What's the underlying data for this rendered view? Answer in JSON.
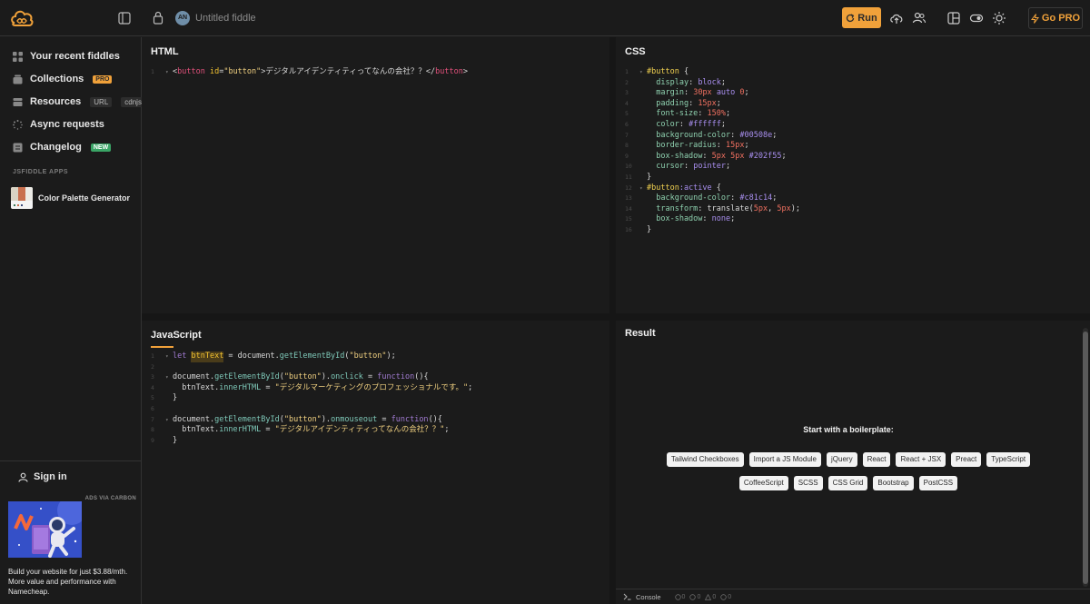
{
  "topbar": {
    "avatar_initials": "AN",
    "fiddle_title": "Untitled fiddle",
    "run_label": "Run",
    "go_pro_label": "Go PRO"
  },
  "sidebar": {
    "items": [
      {
        "label": "Your recent fiddles",
        "icon": "grid-icon"
      },
      {
        "label": "Collections",
        "icon": "box-icon",
        "tag": "PRO"
      },
      {
        "label": "Resources",
        "icon": "stack-icon",
        "tags": [
          "URL",
          "cdnjs"
        ]
      },
      {
        "label": "Async requests",
        "icon": "spinner-icon"
      },
      {
        "label": "Changelog",
        "icon": "list-icon",
        "tag": "NEW"
      }
    ],
    "apps_label": "JSFIDDLE APPS",
    "apps": [
      {
        "label": "Color Palette Generator",
        "icon": "palette-icon"
      }
    ],
    "sign_in": "Sign in",
    "ad_label": "ADS VIA CARBON",
    "ad_text": "Build your website for just $3.88/mth. More value and performance with Namecheap."
  },
  "panels": {
    "html": {
      "title": "HTML"
    },
    "css": {
      "title": "CSS"
    },
    "js": {
      "title": "JavaScript"
    },
    "result": {
      "title": "Result"
    }
  },
  "result": {
    "boilerplate_title": "Start with a boilerplate:",
    "row1": [
      "Tailwind Checkboxes",
      "Import a JS Module",
      "jQuery",
      "React",
      "React + JSX",
      "Preact",
      "TypeScript"
    ],
    "row2": [
      "CoffeeScript",
      "SCSS",
      "CSS Grid",
      "Bootstrap",
      "PostCSS"
    ]
  },
  "console": {
    "label": "Console",
    "counts": [
      "0",
      "0",
      "0",
      "0"
    ]
  },
  "code": {
    "html": [
      [
        [
          "<",
          "t-punc"
        ],
        [
          "button",
          "t-tag"
        ],
        [
          " id",
          "t-attr"
        ],
        [
          "=",
          "t-punc"
        ],
        [
          "\"button\"",
          "t-str"
        ],
        [
          ">デジタルアイデンティティってなんの会社？？</",
          "t-plain"
        ],
        [
          "button",
          "t-tag"
        ],
        [
          ">",
          "t-punc"
        ]
      ]
    ],
    "css": [
      [
        [
          "#button",
          "t-sel"
        ],
        [
          " {",
          "t-punc"
        ]
      ],
      [
        [
          "  display",
          "t-prop"
        ],
        [
          ": ",
          "t-punc"
        ],
        [
          "block",
          "t-val"
        ],
        [
          ";",
          "t-punc"
        ]
      ],
      [
        [
          "  margin",
          "t-prop"
        ],
        [
          ": ",
          "t-punc"
        ],
        [
          "30px",
          "t-num"
        ],
        [
          " ",
          "t-punc"
        ],
        [
          "auto",
          "t-val"
        ],
        [
          " ",
          "t-punc"
        ],
        [
          "0",
          "t-num"
        ],
        [
          ";",
          "t-punc"
        ]
      ],
      [
        [
          "  padding",
          "t-prop"
        ],
        [
          ": ",
          "t-punc"
        ],
        [
          "15px",
          "t-num"
        ],
        [
          ";",
          "t-punc"
        ]
      ],
      [
        [
          "  font-size",
          "t-prop"
        ],
        [
          ": ",
          "t-punc"
        ],
        [
          "150%",
          "t-num"
        ],
        [
          ";",
          "t-punc"
        ]
      ],
      [
        [
          "  color",
          "t-prop"
        ],
        [
          ": ",
          "t-punc"
        ],
        [
          "#ffffff",
          "t-val"
        ],
        [
          ";",
          "t-punc"
        ]
      ],
      [
        [
          "  background-color",
          "t-prop"
        ],
        [
          ": ",
          "t-punc"
        ],
        [
          "#00508e",
          "t-val"
        ],
        [
          ";",
          "t-punc"
        ]
      ],
      [
        [
          "  border-radius",
          "t-prop"
        ],
        [
          ": ",
          "t-punc"
        ],
        [
          "15px",
          "t-num"
        ],
        [
          ";",
          "t-punc"
        ]
      ],
      [
        [
          "  box-shadow",
          "t-prop"
        ],
        [
          ": ",
          "t-punc"
        ],
        [
          "5px",
          "t-num"
        ],
        [
          " ",
          "t-punc"
        ],
        [
          "5px",
          "t-num"
        ],
        [
          " ",
          "t-punc"
        ],
        [
          "#202f55",
          "t-val"
        ],
        [
          ";",
          "t-punc"
        ]
      ],
      [
        [
          "  cursor",
          "t-prop"
        ],
        [
          ": ",
          "t-punc"
        ],
        [
          "pointer",
          "t-val"
        ],
        [
          ";",
          "t-punc"
        ]
      ],
      [
        [
          "}",
          "t-punc"
        ]
      ],
      [
        [
          "#button",
          "t-sel"
        ],
        [
          ":active",
          "t-val"
        ],
        [
          " {",
          "t-punc"
        ]
      ],
      [
        [
          "  background-color",
          "t-prop"
        ],
        [
          ": ",
          "t-punc"
        ],
        [
          "#c81c14",
          "t-val"
        ],
        [
          ";",
          "t-punc"
        ]
      ],
      [
        [
          "  transform",
          "t-prop"
        ],
        [
          ": ",
          "t-punc"
        ],
        [
          "translate(",
          "t-plain"
        ],
        [
          "5px",
          "t-num"
        ],
        [
          ", ",
          "t-punc"
        ],
        [
          "5px",
          "t-num"
        ],
        [
          ");",
          "t-punc"
        ]
      ],
      [
        [
          "  box-shadow",
          "t-prop"
        ],
        [
          ": ",
          "t-punc"
        ],
        [
          "none",
          "t-val"
        ],
        [
          ";",
          "t-punc"
        ]
      ],
      [
        [
          "}",
          "t-punc"
        ]
      ]
    ],
    "js": [
      [
        [
          "let",
          "t-kw"
        ],
        [
          " ",
          "t-punc"
        ],
        [
          "btnText",
          "t-var"
        ],
        [
          " = ",
          "t-punc"
        ],
        [
          "document",
          "t-plain"
        ],
        [
          ".",
          "t-punc"
        ],
        [
          "getElementById",
          "t-fn"
        ],
        [
          "(",
          "t-punc"
        ],
        [
          "\"button\"",
          "t-str"
        ],
        [
          ");",
          "t-punc"
        ]
      ],
      [
        [
          "",
          "t-punc"
        ]
      ],
      [
        [
          "document",
          "t-plain"
        ],
        [
          ".",
          "t-punc"
        ],
        [
          "getElementById",
          "t-fn"
        ],
        [
          "(",
          "t-punc"
        ],
        [
          "\"button\"",
          "t-str"
        ],
        [
          ").",
          "t-punc"
        ],
        [
          "onclick",
          "t-fn"
        ],
        [
          " = ",
          "t-punc"
        ],
        [
          "function",
          "t-kw"
        ],
        [
          "(){",
          "t-punc"
        ]
      ],
      [
        [
          "  btnText",
          "t-plain"
        ],
        [
          ".",
          "t-punc"
        ],
        [
          "innerHTML",
          "t-fn"
        ],
        [
          " = ",
          "t-punc"
        ],
        [
          "\"デジタルマーケティングのプロフェッショナルです。\"",
          "t-str"
        ],
        [
          ";",
          "t-punc"
        ]
      ],
      [
        [
          "}",
          "t-punc"
        ]
      ],
      [
        [
          "",
          "t-punc"
        ]
      ],
      [
        [
          "document",
          "t-plain"
        ],
        [
          ".",
          "t-punc"
        ],
        [
          "getElementById",
          "t-fn"
        ],
        [
          "(",
          "t-punc"
        ],
        [
          "\"button\"",
          "t-str"
        ],
        [
          ").",
          "t-punc"
        ],
        [
          "onmouseout",
          "t-fn"
        ],
        [
          " = ",
          "t-punc"
        ],
        [
          "function",
          "t-kw"
        ],
        [
          "(){",
          "t-punc"
        ]
      ],
      [
        [
          "  btnText",
          "t-plain"
        ],
        [
          ".",
          "t-punc"
        ],
        [
          "innerHTML",
          "t-fn"
        ],
        [
          " = ",
          "t-punc"
        ],
        [
          "\"デジタルアイデンティティってなんの会社？？\"",
          "t-str"
        ],
        [
          ";",
          "t-punc"
        ]
      ],
      [
        [
          "}",
          "t-punc"
        ]
      ]
    ],
    "js_folds": [
      1,
      3,
      7
    ],
    "css_folds": [
      1,
      12
    ],
    "html_folds": [
      1
    ]
  },
  "colors": {
    "accent": "#f0a13a",
    "background": "#1b1b1b",
    "new_badge": "#3aa566"
  }
}
